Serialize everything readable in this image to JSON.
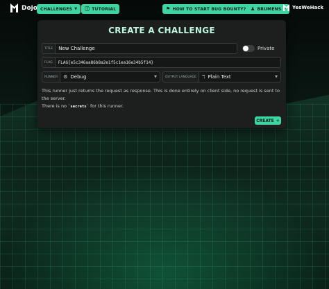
{
  "brand": {
    "name": "Dojo"
  },
  "nav": {
    "challenges_label": "CHALLENGES",
    "tutorial_label": "TUTORIAL",
    "bounty_label": "HOW TO START BUG BOUNTY?",
    "user_label": "BRUMENS",
    "partner_name": "YesWeHack"
  },
  "panel": {
    "title": "CREATE A CHALLENGE",
    "title_field": {
      "label": "TITLE",
      "value": "New Challenge"
    },
    "private_label": "Private",
    "private_enabled": false,
    "flag_field": {
      "label": "FLAG",
      "value": "FLAG{e5c346aa86b8a2e1f5c1ea16e34b5f14}"
    },
    "runner_field": {
      "label": "RUNNER",
      "value": "Debug"
    },
    "output_field": {
      "label": "OUTPUT LANGUAGE",
      "value": "Plain Text"
    },
    "desc_line1": "This runner just returns the request as response. This is done entirely on client side, no request is sent to the server.",
    "desc_line2_prefix": "There is no ",
    "desc_line2_code": "`secrets`",
    "desc_line2_suffix": " for this runner.",
    "create_label": "CREATE"
  },
  "colors": {
    "accent": "#3dd6a3",
    "panel": "#1d1f1f",
    "title": "#bff5df"
  },
  "icons": [
    "dojo-logo",
    "help-circle-icon",
    "flag-icon",
    "user-icon",
    "yeswehack-logo",
    "debug-icon",
    "text-format-icon",
    "chevron-down-icon",
    "plus-icon"
  ]
}
